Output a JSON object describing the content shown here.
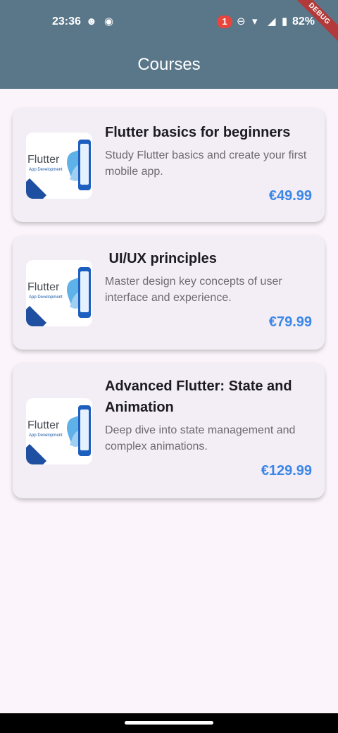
{
  "status_bar": {
    "time": "23:36",
    "notification_count": "1",
    "battery": "82%"
  },
  "debug_banner": "DEBUG",
  "app_bar": {
    "title": "Courses"
  },
  "flutter_logo_text": {
    "word": "Flutter",
    "sub": "App Development"
  },
  "courses": [
    {
      "title": "Flutter basics for beginners",
      "description": "Study Flutter basics and create your first mobile app.",
      "price": "€49.99"
    },
    {
      "title": " UI/UX principles",
      "description": "Master design key concepts of user interface and experience.",
      "price": "€79.99"
    },
    {
      "title": "Advanced Flutter: State and Animation",
      "description": "Deep dive into state management and complex animations.",
      "price": "€129.99"
    }
  ],
  "colors": {
    "app_bar": "#5a778a",
    "background": "#fbf5fb",
    "card": "#f3eef5",
    "price": "#3b86e8"
  }
}
